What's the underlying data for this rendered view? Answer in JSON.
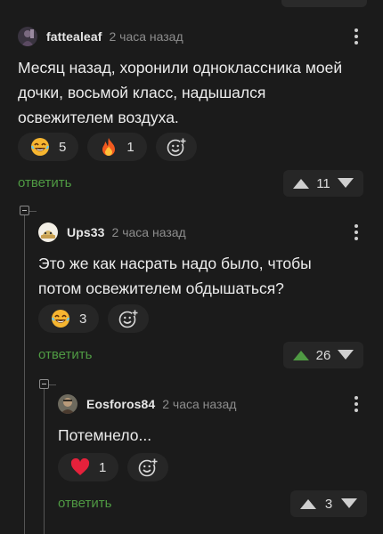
{
  "comments": [
    {
      "author": "fattealeaf",
      "time": "2 часа назад",
      "text_lines": [
        "Месяц назад, хоронили одноклассника моей",
        "дочки, восьмой класс, надышался",
        "освежителем воздуха."
      ],
      "reactions": [
        {
          "icon": "laughing-emoji-icon",
          "count": "5"
        },
        {
          "icon": "fire-icon",
          "count": "1"
        }
      ],
      "reply_label": "ответить",
      "rating": "11",
      "upvoted": false
    },
    {
      "author": "Ups33",
      "time": "2 часа назад",
      "text_lines": [
        "Это же как насрать надо было, чтобы",
        "потом освежителем обдышаться?"
      ],
      "reactions": [
        {
          "icon": "laughing-emoji-icon",
          "count": "3"
        }
      ],
      "reply_label": "ответить",
      "rating": "26",
      "upvoted": true
    },
    {
      "author": "Eosforos84",
      "time": "2 часа назад",
      "text_lines": [
        "Потемнело..."
      ],
      "reactions": [
        {
          "icon": "heart-icon",
          "count": "1"
        }
      ],
      "reply_label": "ответить",
      "rating": "3",
      "upvoted": false
    }
  ],
  "colors": {
    "background": "#1b1b1b",
    "reply_link": "#4f9a43",
    "upvote_active": "#4f9a43",
    "muted": "#8d8d8d"
  }
}
